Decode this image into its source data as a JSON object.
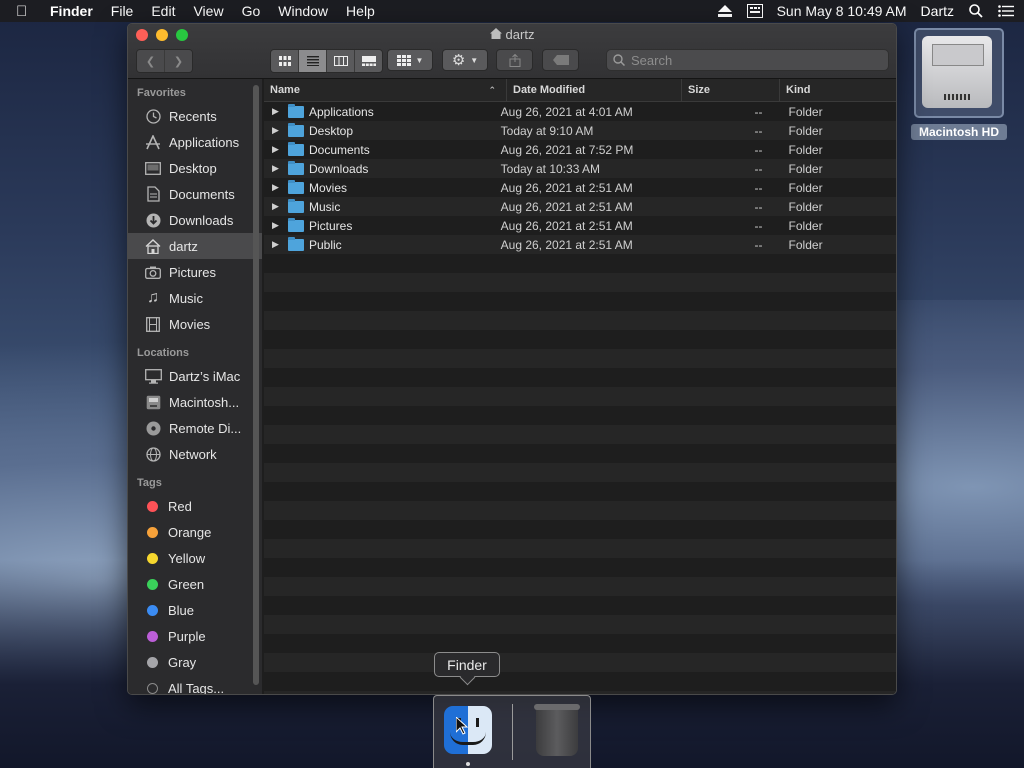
{
  "menubar": {
    "app": "Finder",
    "items": [
      "File",
      "Edit",
      "View",
      "Go",
      "Window",
      "Help"
    ],
    "clock": "Sun May 8  10:49 AM",
    "user": "Dartz"
  },
  "desktop": {
    "drive_label": "Macintosh HD"
  },
  "window": {
    "title": "dartz",
    "search_placeholder": "Search"
  },
  "sidebar": {
    "favorites_header": "Favorites",
    "favorites": [
      {
        "label": "Recents",
        "icon": "clock-icon"
      },
      {
        "label": "Applications",
        "icon": "applications-icon"
      },
      {
        "label": "Desktop",
        "icon": "desktop-icon"
      },
      {
        "label": "Documents",
        "icon": "document-icon"
      },
      {
        "label": "Downloads",
        "icon": "download-icon"
      },
      {
        "label": "dartz",
        "icon": "home-icon"
      },
      {
        "label": "Pictures",
        "icon": "camera-icon"
      },
      {
        "label": "Music",
        "icon": "music-note-icon"
      },
      {
        "label": "Movies",
        "icon": "film-icon"
      }
    ],
    "locations_header": "Locations",
    "locations": [
      {
        "label": "Dartz’s iMac",
        "icon": "computer-icon"
      },
      {
        "label": "Macintosh...",
        "icon": "hard-drive-icon"
      },
      {
        "label": "Remote Di...",
        "icon": "disc-icon"
      },
      {
        "label": "Network",
        "icon": "globe-icon"
      }
    ],
    "tags_header": "Tags",
    "tags": [
      {
        "label": "Red",
        "color": "#ff5257"
      },
      {
        "label": "Orange",
        "color": "#f7a23a"
      },
      {
        "label": "Yellow",
        "color": "#f6d72e"
      },
      {
        "label": "Green",
        "color": "#3ad15a"
      },
      {
        "label": "Blue",
        "color": "#3b8cf3"
      },
      {
        "label": "Purple",
        "color": "#bc5ed8"
      },
      {
        "label": "Gray",
        "color": "#a5a5a9"
      }
    ],
    "all_tags": "All Tags..."
  },
  "list": {
    "columns": {
      "name": "Name",
      "date": "Date Modified",
      "size": "Size",
      "kind": "Kind"
    },
    "rows": [
      {
        "name": "Applications",
        "date": "Aug 26, 2021 at 4:01 AM",
        "size": "--",
        "kind": "Folder"
      },
      {
        "name": "Desktop",
        "date": "Today at 9:10 AM",
        "size": "--",
        "kind": "Folder"
      },
      {
        "name": "Documents",
        "date": "Aug 26, 2021 at 7:52 PM",
        "size": "--",
        "kind": "Folder"
      },
      {
        "name": "Downloads",
        "date": "Today at 10:33 AM",
        "size": "--",
        "kind": "Folder"
      },
      {
        "name": "Movies",
        "date": "Aug 26, 2021 at 2:51 AM",
        "size": "--",
        "kind": "Folder"
      },
      {
        "name": "Music",
        "date": "Aug 26, 2021 at 2:51 AM",
        "size": "--",
        "kind": "Folder"
      },
      {
        "name": "Pictures",
        "date": "Aug 26, 2021 at 2:51 AM",
        "size": "--",
        "kind": "Folder"
      },
      {
        "name": "Public",
        "date": "Aug 26, 2021 at 2:51 AM",
        "size": "--",
        "kind": "Folder"
      }
    ]
  },
  "dock": {
    "tooltip": "Finder"
  }
}
